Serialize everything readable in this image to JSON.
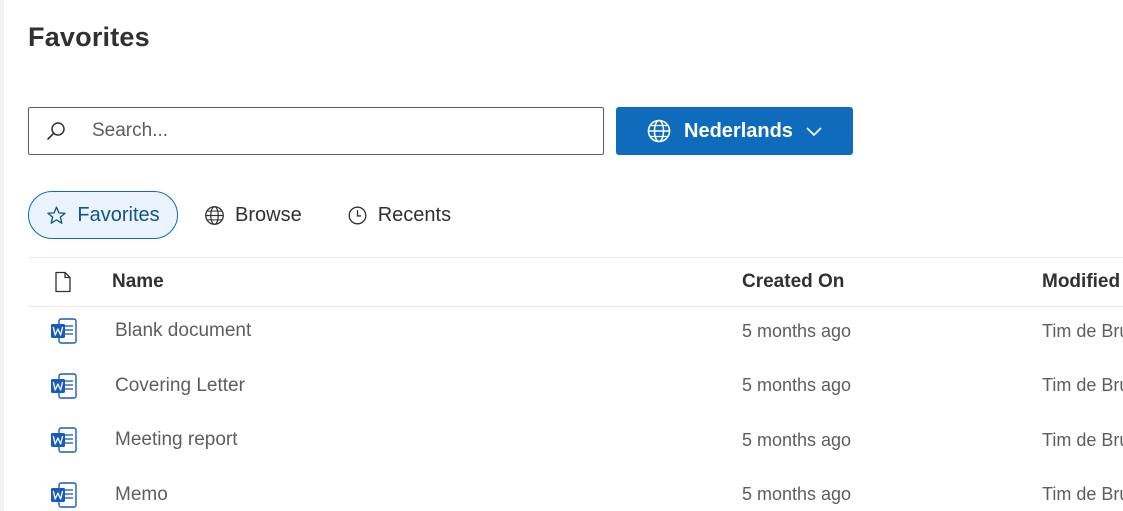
{
  "page": {
    "title": "Favorites"
  },
  "search": {
    "placeholder": "Search..."
  },
  "language_button": {
    "label": "Nederlands"
  },
  "tabs": [
    {
      "label": "Favorites",
      "selected": true
    },
    {
      "label": "Browse",
      "selected": false
    },
    {
      "label": "Recents",
      "selected": false
    }
  ],
  "table": {
    "columns": {
      "name": "Name",
      "created": "Created On",
      "modified": "Modified"
    },
    "rows": [
      {
        "name": "Blank document",
        "created": "5 months ago",
        "modified": "Tim de Bru"
      },
      {
        "name": "Covering Letter",
        "created": "5 months ago",
        "modified": "Tim de Bru"
      },
      {
        "name": "Meeting report",
        "created": "5 months ago",
        "modified": "Tim de Bru"
      },
      {
        "name": "Memo",
        "created": "5 months ago",
        "modified": "Tim de Bru"
      }
    ]
  },
  "icons": {
    "search": "search-icon",
    "language": "globe-icon",
    "dropdown": "chevron-down-icon",
    "favorites_tab": "star-icon",
    "browse_tab": "globe-icon",
    "recents_tab": "clock-icon",
    "file_type_column": "document-icon",
    "row_file": "word-document-icon"
  },
  "colors": {
    "accent": "#0f6cbd",
    "accent_dark": "#0f548c",
    "selected_tab_bg": "#ebf3fc",
    "text_primary": "#323130",
    "text_secondary": "#605e5c",
    "word_blue": "#185abd"
  }
}
